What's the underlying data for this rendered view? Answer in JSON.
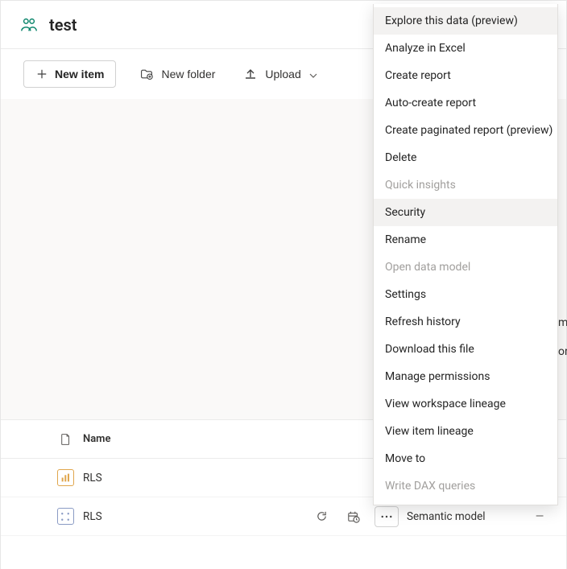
{
  "header": {
    "workspace_title": "test"
  },
  "toolbar": {
    "new_item_label": "New item",
    "new_folder_label": "New folder",
    "upload_label": "Upload"
  },
  "table": {
    "columns": {
      "name": "Name"
    },
    "rows": [
      {
        "name": "RLS",
        "type_label": "",
        "icon": "bars"
      },
      {
        "name": "RLS",
        "type_label": "Semantic model",
        "icon": "model",
        "owner": "—"
      }
    ]
  },
  "context_menu": {
    "items": [
      {
        "label": "Explore this data (preview)",
        "enabled": true,
        "hovered": true
      },
      {
        "label": "Analyze in Excel",
        "enabled": true
      },
      {
        "label": "Create report",
        "enabled": true
      },
      {
        "label": "Auto-create report",
        "enabled": true
      },
      {
        "label": "Create paginated report (preview)",
        "enabled": true
      },
      {
        "label": "Delete",
        "enabled": true
      },
      {
        "label": "Quick insights",
        "enabled": false
      },
      {
        "label": "Security",
        "enabled": true,
        "hovered": true
      },
      {
        "label": "Rename",
        "enabled": true
      },
      {
        "label": "Open data model",
        "enabled": false
      },
      {
        "label": "Settings",
        "enabled": true
      },
      {
        "label": "Refresh history",
        "enabled": true
      },
      {
        "label": "Download this file",
        "enabled": true
      },
      {
        "label": "Manage permissions",
        "enabled": true
      },
      {
        "label": "View workspace lineage",
        "enabled": true
      },
      {
        "label": "View item lineage",
        "enabled": true
      },
      {
        "label": "Move to",
        "enabled": true
      },
      {
        "label": "Write DAX queries",
        "enabled": false
      }
    ]
  },
  "bg_fragments": {
    "line1": "m",
    "line2": "or"
  }
}
